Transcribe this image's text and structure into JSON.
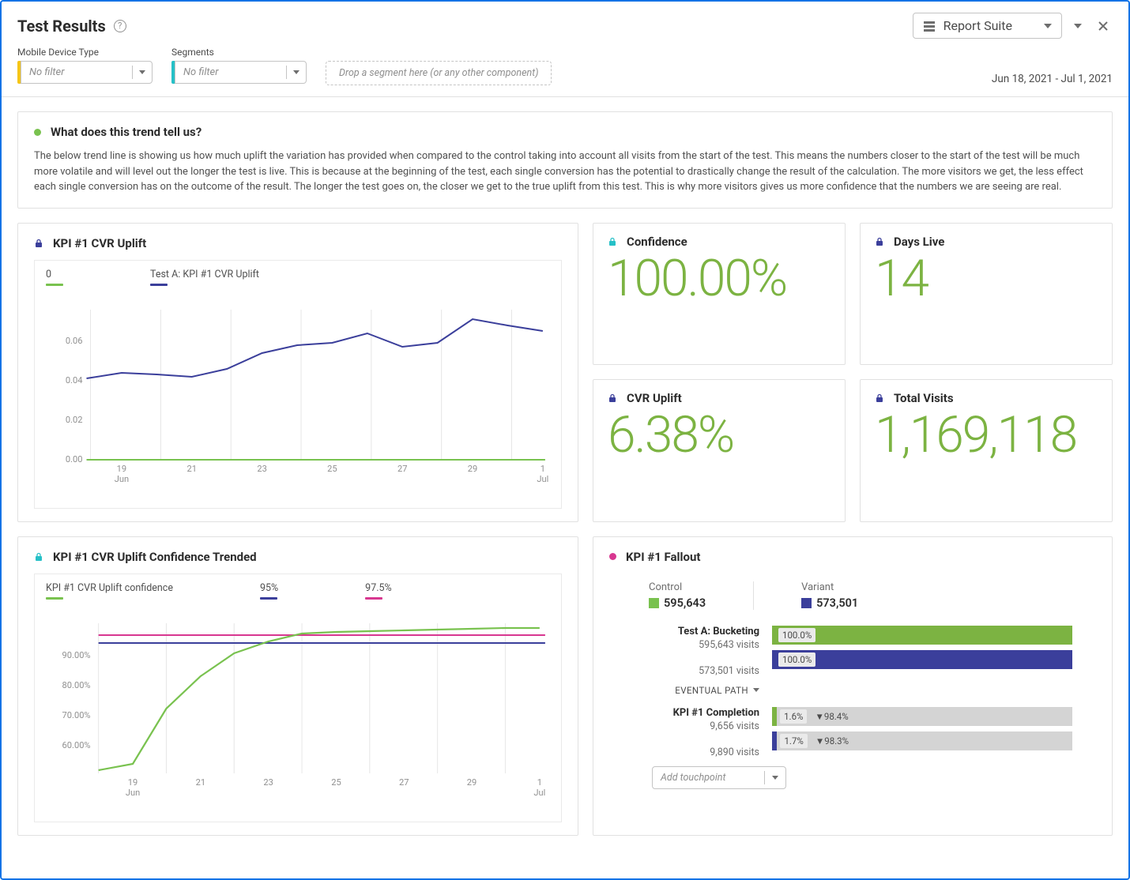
{
  "header": {
    "title": "Test Results",
    "report_suite_label": "Report Suite"
  },
  "filters": {
    "mobile_label": "Mobile Device Type",
    "mobile_value": "No filter",
    "segments_label": "Segments",
    "segments_value": "No filter",
    "dropzone": "Drop a segment here (or any other component)",
    "date_range": "Jun 18, 2021 - Jul 1, 2021"
  },
  "trend_panel": {
    "title": "What does this trend tell us?",
    "body": "The below trend line is showing us how much uplift the variation has provided when compared to the control taking into account all visits from the start of the test. This means the numbers closer to the start of the test will be much more volatile and will level out the longer the test is live. This is because at the beginning of the test, each single conversion has the potential to drastically change the result of the calculation. The more visitors we get, the less effect each single conversion has on the outcome of the result. The longer the test goes on, the closer we get to the true uplift from this test. This is why more visitors gives us more confidence that the numbers we are seeing are real."
  },
  "kpi_chart": {
    "title": "KPI #1 CVR Uplift",
    "legend": {
      "zero": "0",
      "series": "Test A: KPI #1 CVR Uplift"
    }
  },
  "metrics": {
    "confidence": {
      "title": "Confidence",
      "value": "100.00%"
    },
    "days_live": {
      "title": "Days Live",
      "value": "14"
    },
    "cvr_uplift": {
      "title": "CVR Uplift",
      "value": "6.38%"
    },
    "total_visits": {
      "title": "Total Visits",
      "value": "1,169,118"
    }
  },
  "confidence_chart": {
    "title": "KPI #1 CVR Uplift Confidence Trended",
    "legend": {
      "conf": "KPI #1 CVR Uplift confidence",
      "p95": "95%",
      "p975": "97.5%"
    }
  },
  "fallout": {
    "title": "KPI #1 Fallout",
    "control_label": "Control",
    "control_value": "595,643",
    "variant_label": "Variant",
    "variant_value": "573,501",
    "step1": {
      "title": "Test A: Bucketing",
      "control_visits": "595,643 visits",
      "variant_visits": "573,501 visits",
      "control_pct": "100.0%",
      "variant_pct": "100.0%"
    },
    "path": "EVENTUAL PATH",
    "step2": {
      "title": "KPI #1 Completion",
      "control_visits": "9,656 visits",
      "variant_visits": "9,890 visits",
      "control_pct": "1.6%",
      "control_chg": "▼98.4%",
      "variant_pct": "1.7%",
      "variant_chg": "▼98.3%"
    },
    "add": "Add touchpoint"
  },
  "chart_data": [
    {
      "type": "line",
      "title": "KPI #1 CVR Uplift",
      "x_ticks": [
        "19",
        "21",
        "23",
        "25",
        "27",
        "29",
        "1"
      ],
      "x_sublabels": [
        "Jun",
        "",
        "",
        "",
        "",
        "",
        "Jul"
      ],
      "ylim": [
        0,
        0.08
      ],
      "y_ticks": [
        0.0,
        0.02,
        0.04,
        0.06
      ],
      "series": [
        {
          "name": "0",
          "color": "#79c24f",
          "values": [
            0,
            0,
            0,
            0,
            0,
            0,
            0,
            0,
            0,
            0,
            0,
            0,
            0,
            0
          ]
        },
        {
          "name": "Test A: KPI #1 CVR Uplift",
          "color": "#3b3f9b",
          "values": [
            0.041,
            0.044,
            0.043,
            0.042,
            0.046,
            0.054,
            0.058,
            0.059,
            0.064,
            0.057,
            0.059,
            0.071,
            0.068,
            0.065
          ]
        }
      ]
    },
    {
      "type": "line",
      "title": "KPI #1 CVR Uplift Confidence Trended",
      "x_ticks": [
        "19",
        "21",
        "23",
        "25",
        "27",
        "29",
        "1"
      ],
      "x_sublabels": [
        "Jun",
        "",
        "",
        "",
        "",
        "",
        "Jul"
      ],
      "ylim": [
        50,
        100
      ],
      "y_ticks": [
        60,
        70,
        80,
        90
      ],
      "series": [
        {
          "name": "KPI #1 CVR Uplift confidence",
          "color": "#79c24f",
          "values": [
            53,
            55,
            73,
            84,
            91.5,
            95.5,
            97.8,
            98.4,
            98.7,
            98.9,
            99.0,
            99.2,
            99.3,
            99.3
          ]
        },
        {
          "name": "95%",
          "color": "#3b3f9b",
          "values": [
            95,
            95,
            95,
            95,
            95,
            95,
            95,
            95,
            95,
            95,
            95,
            95,
            95,
            95
          ]
        },
        {
          "name": "97.5%",
          "color": "#d83790",
          "values": [
            97.5,
            97.5,
            97.5,
            97.5,
            97.5,
            97.5,
            97.5,
            97.5,
            97.5,
            97.5,
            97.5,
            97.5,
            97.5,
            97.5
          ]
        }
      ]
    },
    {
      "type": "bar",
      "title": "KPI #1 Fallout",
      "stages": [
        {
          "name": "Test A: Bucketing",
          "control": {
            "visits": 595643,
            "pct": 100.0
          },
          "variant": {
            "visits": 573501,
            "pct": 100.0
          }
        },
        {
          "name": "KPI #1 Completion",
          "control": {
            "visits": 9656,
            "pct": 1.6,
            "change": -98.4
          },
          "variant": {
            "visits": 9890,
            "pct": 1.7,
            "change": -98.3
          }
        }
      ]
    }
  ]
}
